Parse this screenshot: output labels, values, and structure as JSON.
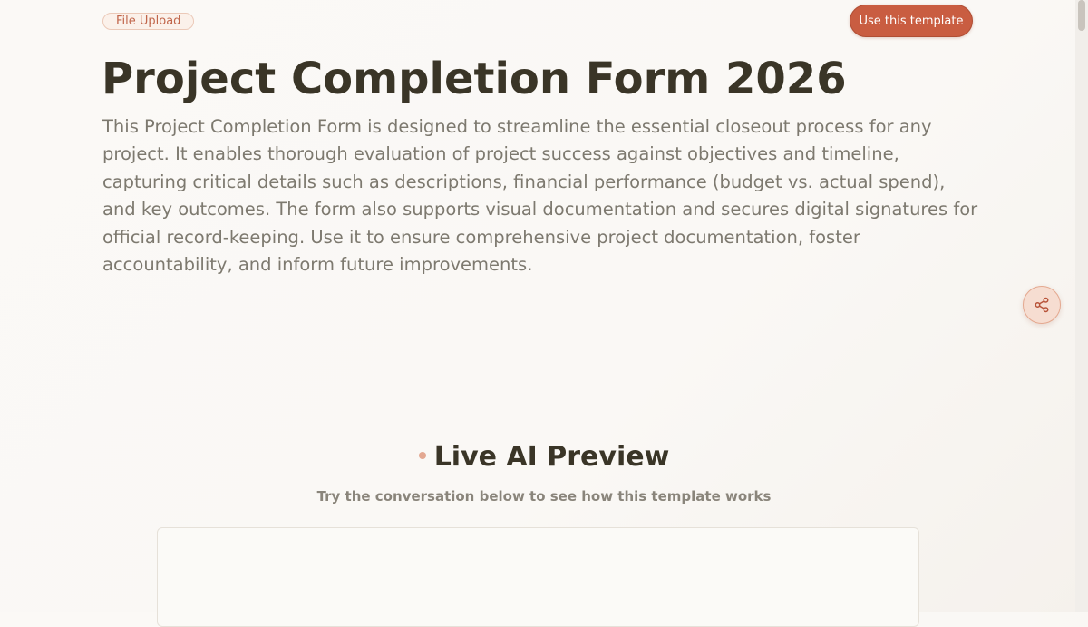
{
  "header": {
    "tag_label": "File Upload",
    "cta_label": "Use this template"
  },
  "main": {
    "title": "Project Completion Form 2026",
    "description": "This Project Completion Form is designed to streamline the essential closeout process for any project. It enables thorough evaluation of project success against objectives and timeline, capturing critical details such as descriptions, financial performance (budget vs. actual spend), and key outcomes. The form also supports visual documentation and secures digital signatures for official record-keeping. Use it to ensure comprehensive project documentation, foster accountability, and inform future improvements."
  },
  "preview": {
    "title": "Live AI Preview",
    "subtitle": "Try the conversation below to see how this template works"
  },
  "icons": {
    "share": "share-icon"
  },
  "colors": {
    "accent": "#c95d41",
    "tag_text": "#c0654a",
    "heading": "#3a3527",
    "body_text": "#7d796f",
    "share_bg": "#f6ddd1"
  }
}
